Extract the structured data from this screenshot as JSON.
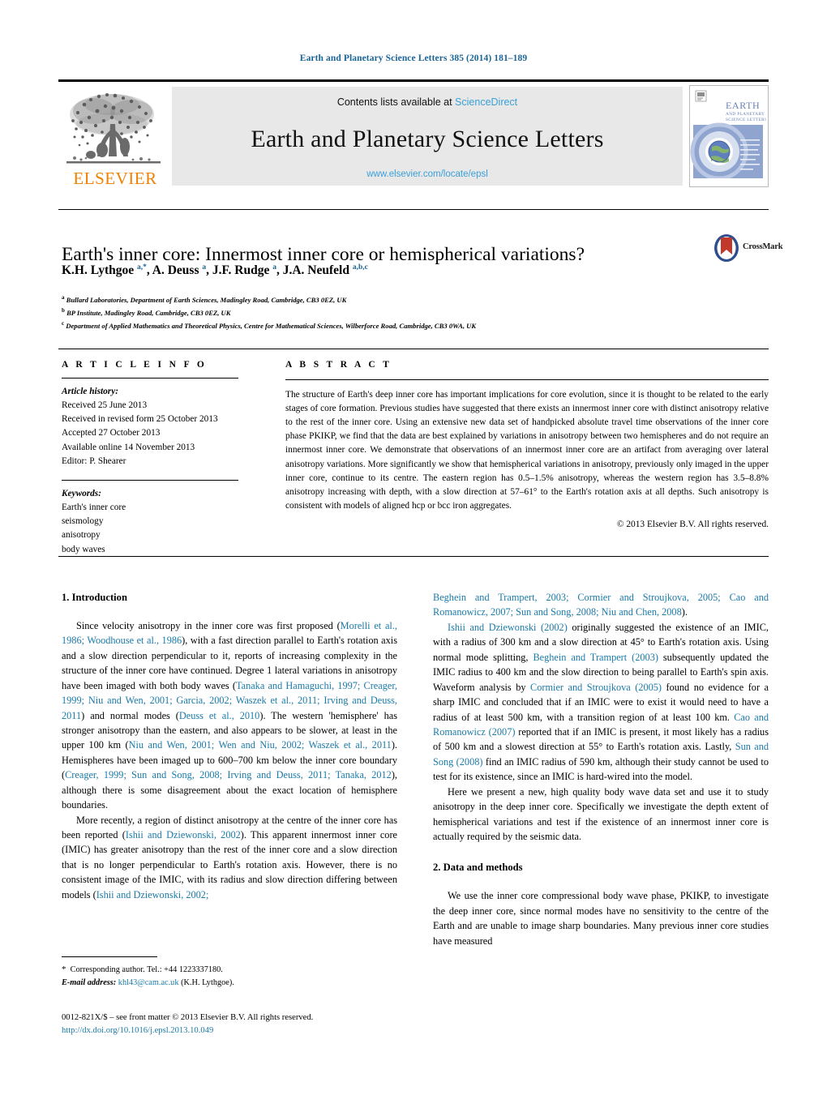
{
  "running_head": "Earth and Planetary Science Letters 385 (2014) 181–189",
  "masthead": {
    "contents_prefix": "Contents lists available at ",
    "sciencedirect": "ScienceDirect",
    "journal_name": "Earth and Planetary Science Letters",
    "url": "www.elsevier.com/locate/epsl",
    "publisher": "ELSEVIER",
    "cover_title_line1": "EARTH",
    "cover_title_line2": "AND PLANETARY",
    "cover_title_line3": "SCIENCE LETTERS"
  },
  "article": {
    "title": "Earth's inner core: Innermost inner core or hemispherical variations?",
    "crossmark_label": "CrossMark",
    "authors_html": "K.H. Lythgoe <sup>a,*</sup>, A. Deuss <sup>a</sup>, J.F. Rudge <sup>a</sup>, J.A. Neufeld <sup>a,b,c</sup>",
    "affiliations": [
      {
        "marker": "a",
        "text": "Bullard Laboratories, Department of Earth Sciences, Madingley Road, Cambridge, CB3 0EZ, UK"
      },
      {
        "marker": "b",
        "text": "BP Institute, Madingley Road, Cambridge, CB3 0EZ, UK"
      },
      {
        "marker": "c",
        "text": "Department of Applied Mathematics and Theoretical Physics, Centre for Mathematical Sciences, Wilberforce Road, Cambridge, CB3 0WA, UK"
      }
    ]
  },
  "article_info": {
    "heading": "A R T I C L E   I N F O",
    "history_label": "Article history:",
    "history": [
      "Received 25 June 2013",
      "Received in revised form 25 October 2013",
      "Accepted 27 October 2013",
      "Available online 14 November 2013",
      "Editor: P. Shearer"
    ],
    "keywords_label": "Keywords:",
    "keywords": [
      "Earth's inner core",
      "seismology",
      "anisotropy",
      "body waves"
    ]
  },
  "abstract": {
    "heading": "A B S T R A C T",
    "text": "The structure of Earth's deep inner core has important implications for core evolution, since it is thought to be related to the early stages of core formation. Previous studies have suggested that there exists an innermost inner core with distinct anisotropy relative to the rest of the inner core. Using an extensive new data set of handpicked absolute travel time observations of the inner core phase PKIKP, we find that the data are best explained by variations in anisotropy between two hemispheres and do not require an innermost inner core. We demonstrate that observations of an innermost inner core are an artifact from averaging over lateral anisotropy variations. More significantly we show that hemispherical variations in anisotropy, previously only imaged in the upper inner core, continue to its centre. The eastern region has 0.5–1.5% anisotropy, whereas the western region has 3.5–8.8% anisotropy increasing with depth, with a slow direction at 57–61° to the Earth's rotation axis at all depths. Such anisotropy is consistent with models of aligned hcp or bcc iron aggregates.",
    "copyright": "© 2013 Elsevier B.V. All rights reserved."
  },
  "sections": {
    "introduction_heading": "1. Introduction",
    "data_methods_heading": "2. Data and methods"
  },
  "body": {
    "left_p1_html": "Since velocity anisotropy in the inner core was first proposed (<span class=\"cite\">Morelli et al., 1986; Woodhouse et al., 1986</span>), with a fast direction parallel to Earth's rotation axis and a slow direction perpendicular to it, reports of increasing complexity in the structure of the inner core have continued. Degree 1 lateral variations in anisotropy have been imaged with both body waves (<span class=\"cite\">Tanaka and Hamaguchi, 1997; Creager, 1999; Niu and Wen, 2001; Garcia, 2002; Waszek et al., 2011; Irving and Deuss, 2011</span>) and normal modes (<span class=\"cite\">Deuss et al., 2010</span>). The western 'hemisphere' has stronger anisotropy than the eastern, and also appears to be slower, at least in the upper 100 km (<span class=\"cite\">Niu and Wen, 2001; Wen and Niu, 2002; Waszek et al., 2011</span>). Hemispheres have been imaged up to 600–700 km below the inner core boundary (<span class=\"cite\">Creager, 1999; Sun and Song, 2008; Irving and Deuss, 2011; Tanaka, 2012</span>), although there is some disagreement about the exact location of hemisphere boundaries.",
    "left_p2_html": "More recently, a region of distinct anisotropy at the centre of the inner core has been reported (<span class=\"cite\">Ishii and Dziewonski, 2002</span>). This apparent innermost inner core (IMIC) has greater anisotropy than the rest of the inner core and a slow direction that is no longer perpendicular to Earth's rotation axis. However, there is no consistent image of the IMIC, with its radius and slow direction differing between models (<span class=\"cite\">Ishii and Dziewonski, 2002;</span>",
    "right_p1_html": "<span class=\"cite\">Beghein and Trampert, 2003; Cormier and Stroujkova, 2005; Cao and Romanowicz, 2007; Sun and Song, 2008; Niu and Chen, 2008</span>).",
    "right_p2_html": "<span class=\"cite\">Ishii and Dziewonski (2002)</span> originally suggested the existence of an IMIC, with a radius of 300 km and a slow direction at 45° to Earth's rotation axis. Using normal mode splitting, <span class=\"cite\">Beghein and Trampert (2003)</span> subsequently updated the IMIC radius to 400 km and the slow direction to being parallel to Earth's spin axis. Waveform analysis by <span class=\"cite\">Cormier and Stroujkova (2005)</span> found no evidence for a sharp IMIC and concluded that if an IMIC were to exist it would need to have a radius of at least 500 km, with a transition region of at least 100 km. <span class=\"cite\">Cao and Romanowicz (2007)</span> reported that if an IMIC is present, it most likely has a radius of 500 km and a slowest direction at 55° to Earth's rotation axis. Lastly, <span class=\"cite\">Sun and Song (2008)</span> find an IMIC radius of 590 km, although their study cannot be used to test for its existence, since an IMIC is hard-wired into the model.",
    "right_p3_html": "Here we present a new, high quality body wave data set and use it to study anisotropy in the deep inner core. Specifically we investigate the depth extent of hemispherical variations and test if the existence of an innermost inner core is actually required by the seismic data.",
    "right_p4_html": "We use the inner core compressional body wave phase, PKIKP, to investigate the deep inner core, since normal modes have no sensitivity to the centre of the Earth and are unable to image sharp boundaries. Many previous inner core studies have measured"
  },
  "footnote": {
    "corresponding_html": "<span class=\"star\">*</span>&nbsp; Corresponding author. Tel.: +44 1223337180.",
    "email_label": "E-mail address:",
    "email": "khl43@cam.ac.uk",
    "email_suffix": "(K.H. Lythgoe)."
  },
  "imprint": {
    "line1": "0012-821X/$ – see front matter © 2013 Elsevier B.V. All rights reserved.",
    "doi": "http://dx.doi.org/10.1016/j.epsl.2013.10.049"
  },
  "colors": {
    "link_blue": "#1a7aa8",
    "header_blue": "#1a6496",
    "sciencedirect_blue": "#3aa0d8",
    "elsevier_orange": "#F08000",
    "band_grey": "#e8e8e8"
  }
}
